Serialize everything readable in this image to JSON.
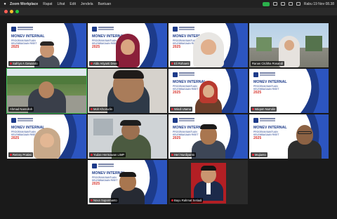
{
  "menubar": {
    "app": "Zoom Workplace",
    "items": [
      "Rapat",
      "Lihat",
      "Edit",
      "Jendela",
      "Bantuan"
    ],
    "datetime": "Rabu 19 Nov  08.38"
  },
  "slide": {
    "title": "MONEV INTERNAL",
    "subtitle": "PROGRAM BANTUAN KELEMBAGAAN RISET",
    "year": "2025"
  },
  "colors": {
    "accent_green": "#3fbf5a",
    "slide_blue": "#1d3b8a",
    "slide_red": "#d6332c"
  },
  "participants": [
    {
      "name": "Safriyo A Gewando",
      "icon": "mic-muted-icon"
    },
    {
      "name": "Aldo Ariyanti Dewi",
      "icon": "mic-muted-icon"
    },
    {
      "name": "Eli Rohaeni",
      "icon": "mic-muted-icon"
    },
    {
      "name": "Ranas Citditha Rosandi",
      "icon": ""
    },
    {
      "name": "Ahmad Nasrulloh",
      "icon": ""
    },
    {
      "name": "Moh Khoirudin",
      "icon": "mic-muted-icon"
    },
    {
      "name": "Windi Utama",
      "icon": "mic-muted-icon"
    },
    {
      "name": "Istiqom Nurrulin",
      "icon": "mic-muted-icon"
    },
    {
      "name": "Retnny Pratiwi",
      "icon": "mic-muted-icon"
    },
    {
      "name": "Yudan Hermawan LIMP",
      "icon": "mic-muted-icon"
    },
    {
      "name": "Heri Nurdiyanto",
      "icon": "mic-muted-icon"
    },
    {
      "name": "Mujianto",
      "icon": "mic-muted-icon"
    },
    {
      "name": "Nova Suparmanto",
      "icon": "mic-muted-icon"
    },
    {
      "name": "Bayu Rahmat Setiadi",
      "icon": "mic-muted-icon"
    }
  ]
}
